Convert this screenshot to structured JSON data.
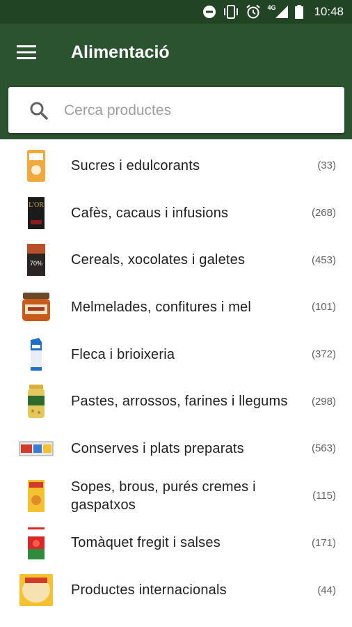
{
  "status_bar": {
    "time": "10:48",
    "network": "4G"
  },
  "app_bar": {
    "title": "Alimentació"
  },
  "search": {
    "placeholder": "Cerca productes",
    "value": ""
  },
  "categories": [
    {
      "label": "Sucres i edulcorants",
      "count": "(33)",
      "icon": "sugar-package-icon"
    },
    {
      "label": "Cafès, cacaus i infusions",
      "count": "(268)",
      "icon": "coffee-box-icon"
    },
    {
      "label": "Cereals, xocolates i galetes",
      "count": "(453)",
      "icon": "chocolate-bar-icon"
    },
    {
      "label": "Melmelades, confitures i mel",
      "count": "(101)",
      "icon": "jam-jar-icon"
    },
    {
      "label": "Fleca i brioixeria",
      "count": "(372)",
      "icon": "bread-bag-icon"
    },
    {
      "label": "Pastes, arrossos, farines i llegums",
      "count": "(298)",
      "icon": "legumes-jar-icon"
    },
    {
      "label": "Conserves i plats preparats",
      "count": "(563)",
      "icon": "canned-food-icon"
    },
    {
      "label": "Sopes, brous, purés cremes i gaspatxos",
      "count": "(115)",
      "icon": "soup-box-icon"
    },
    {
      "label": "Tomàquet fregit i salses",
      "count": "(171)",
      "icon": "tomato-sauce-icon"
    },
    {
      "label": "Productes internacionals",
      "count": "(44)",
      "icon": "tortilla-pack-icon"
    }
  ],
  "colors": {
    "status_bar": "#214524",
    "app_bar": "#2c5330",
    "text": "#212121",
    "count_text": "#616161"
  }
}
